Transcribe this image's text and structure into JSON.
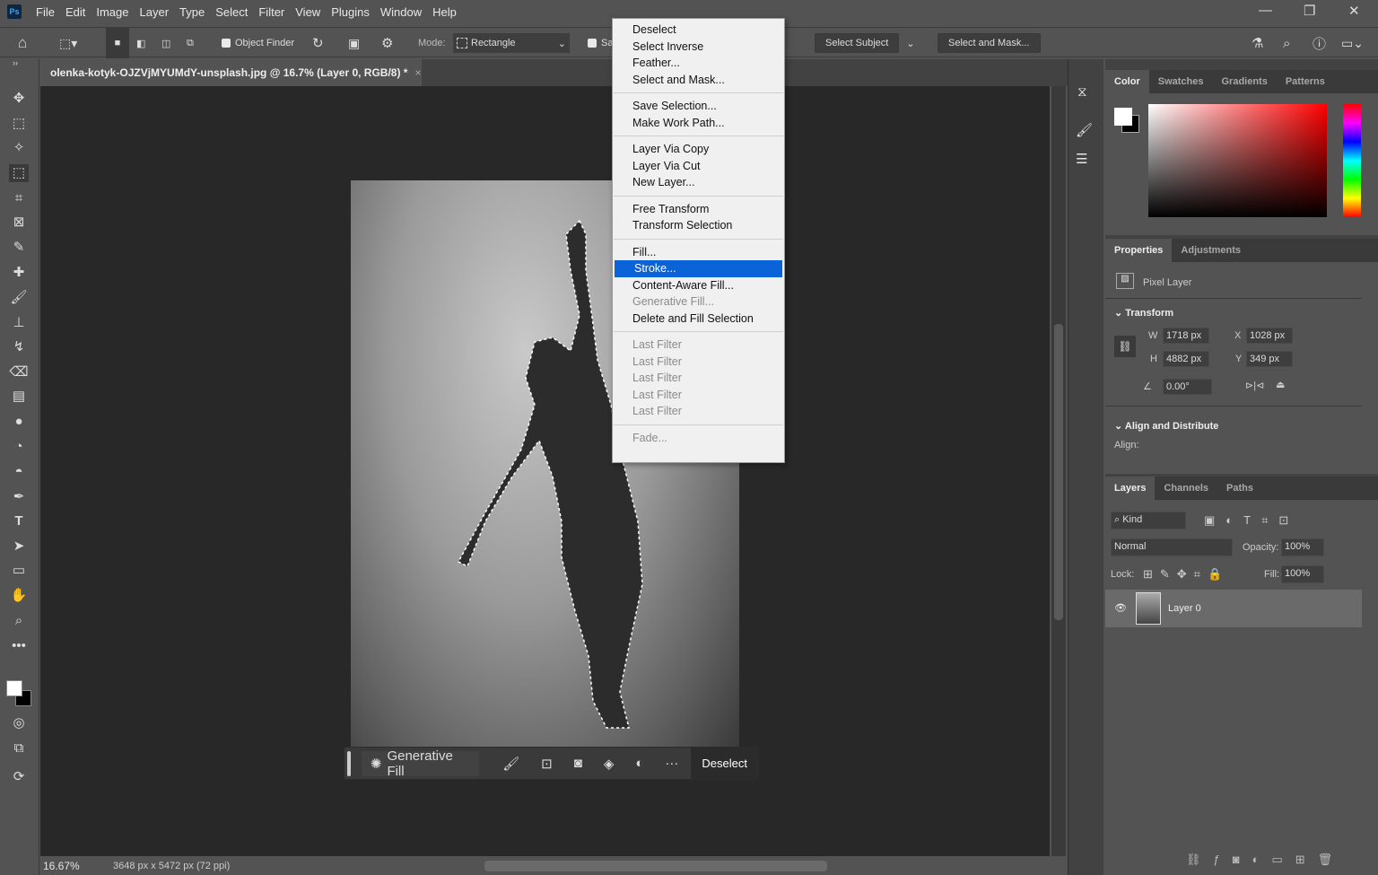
{
  "app": {
    "logo": "Ps",
    "menu": [
      "File",
      "Edit",
      "Image",
      "Layer",
      "Type",
      "Select",
      "Filter",
      "View",
      "Plugins",
      "Window",
      "Help"
    ]
  },
  "options": {
    "object_finder": "Object Finder",
    "mode_label": "Mode:",
    "mode_value": "Rectangle",
    "sample_label": "Sa",
    "select_subject": "Select Subject",
    "select_and_mask": "Select and Mask..."
  },
  "document": {
    "tab_title": "olenka-kotyk-OJZVjMYUMdY-unsplash.jpg @ 16.7% (Layer 0, RGB/8) *",
    "zoom": "16.67%",
    "info": "3648 px x 5472 px (72 ppi)"
  },
  "context_bar": {
    "generative_fill": "Generative Fill",
    "deselect": "Deselect"
  },
  "context_menu": {
    "groups": [
      [
        {
          "label": "Deselect"
        },
        {
          "label": "Select Inverse"
        },
        {
          "label": "Feather..."
        },
        {
          "label": "Select and Mask..."
        }
      ],
      [
        {
          "label": "Save Selection..."
        },
        {
          "label": "Make Work Path..."
        }
      ],
      [
        {
          "label": "Layer Via Copy"
        },
        {
          "label": "Layer Via Cut"
        },
        {
          "label": "New Layer..."
        }
      ],
      [
        {
          "label": "Free Transform"
        },
        {
          "label": "Transform Selection"
        }
      ],
      [
        {
          "label": "Fill..."
        },
        {
          "label": "Stroke...",
          "highlighted": true
        },
        {
          "label": "Content-Aware Fill..."
        },
        {
          "label": "Generative Fill...",
          "disabled": true
        },
        {
          "label": "Delete and Fill Selection"
        }
      ],
      [
        {
          "label": "Last Filter",
          "disabled": true
        },
        {
          "label": "Last Filter",
          "disabled": true
        },
        {
          "label": "Last Filter",
          "disabled": true
        },
        {
          "label": "Last Filter",
          "disabled": true
        },
        {
          "label": "Last Filter",
          "disabled": true
        }
      ],
      [
        {
          "label": "Fade...",
          "disabled": true
        }
      ]
    ]
  },
  "color_panel": {
    "tabs": [
      "Color",
      "Swatches",
      "Gradients",
      "Patterns"
    ],
    "hue": "#ff0000"
  },
  "properties": {
    "tabs": [
      "Properties",
      "Adjustments"
    ],
    "kind": "Pixel Layer",
    "transform_title": "Transform",
    "w_label": "W",
    "w": "1718 px",
    "h_label": "H",
    "h": "4882 px",
    "x_label": "X",
    "x": "1028 px",
    "y_label": "Y",
    "y": "349 px",
    "angle": "0.00°",
    "align_title": "Align and Distribute",
    "align_label": "Align:"
  },
  "layers": {
    "tabs": [
      "Layers",
      "Channels",
      "Paths"
    ],
    "filter": "Kind",
    "blend": "Normal",
    "opacity_label": "Opacity:",
    "opacity": "100%",
    "lock_label": "Lock:",
    "fill_label": "Fill:",
    "fill": "100%",
    "items": [
      {
        "name": "Layer 0",
        "visible": true
      }
    ]
  }
}
